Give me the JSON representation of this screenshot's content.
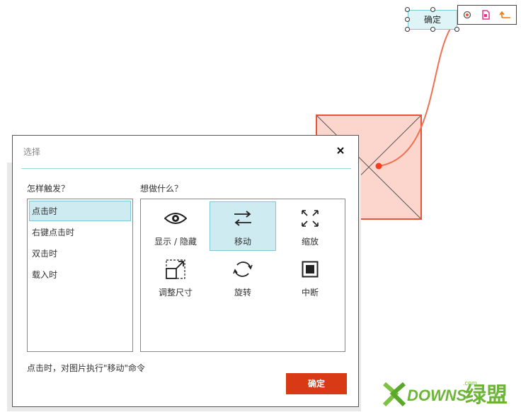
{
  "canvas": {
    "button_label": "确定",
    "mini_toolbar_icons": [
      "target-icon",
      "page-icon",
      "return-arrow-icon"
    ],
    "accent_color": "#e8543a"
  },
  "dialog": {
    "title": "选择",
    "close_icon": "close-icon",
    "trigger_section_label": "怎样触发？",
    "action_section_label": "想做什么？",
    "triggers": [
      {
        "label": "点击时",
        "selected": true
      },
      {
        "label": "右键点击时",
        "selected": false
      },
      {
        "label": "双击时",
        "selected": false
      },
      {
        "label": "载入时",
        "selected": false
      }
    ],
    "actions": [
      {
        "label": "显示 / 隐藏",
        "icon": "eye-icon",
        "selected": false
      },
      {
        "label": "移动",
        "icon": "move-arrows-icon",
        "selected": true
      },
      {
        "label": "缩放",
        "icon": "expand-icon",
        "selected": false
      },
      {
        "label": "调整尺寸",
        "icon": "resize-icon",
        "selected": false
      },
      {
        "label": "旋转",
        "icon": "rotate-icon",
        "selected": false
      },
      {
        "label": "中断",
        "icon": "stop-icon",
        "selected": false
      }
    ],
    "summary_text": "点击时，对图片执行\"移动\"命令",
    "confirm_label": "确定",
    "confirm_color": "#d83a16",
    "selection_color": "#cdebf0"
  },
  "watermark": {
    "text": "DOWNS绿盟",
    "suffix": ".com"
  }
}
